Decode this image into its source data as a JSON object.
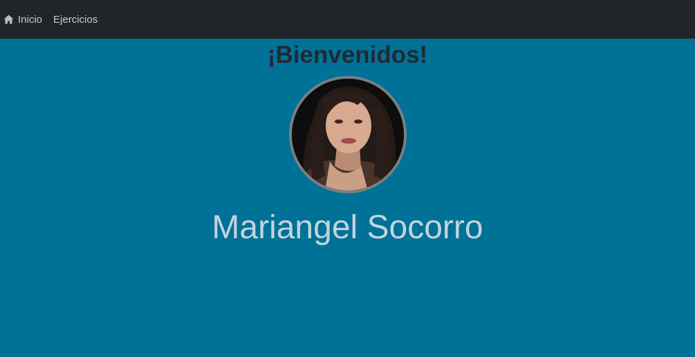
{
  "navbar": {
    "home_label": "Inicio",
    "home_icon": "home-icon",
    "exercises_label": "Ejercicios"
  },
  "main": {
    "title": "¡Bienvenidos!",
    "name": "Mariangel Socorro"
  },
  "colors": {
    "page_background": "#007197",
    "navbar_background": "#212529",
    "nav_text": "#c9cbce",
    "title_text": "#1f2a33",
    "name_text": "#c3d3dd",
    "avatar_border": "#7b7f82"
  }
}
